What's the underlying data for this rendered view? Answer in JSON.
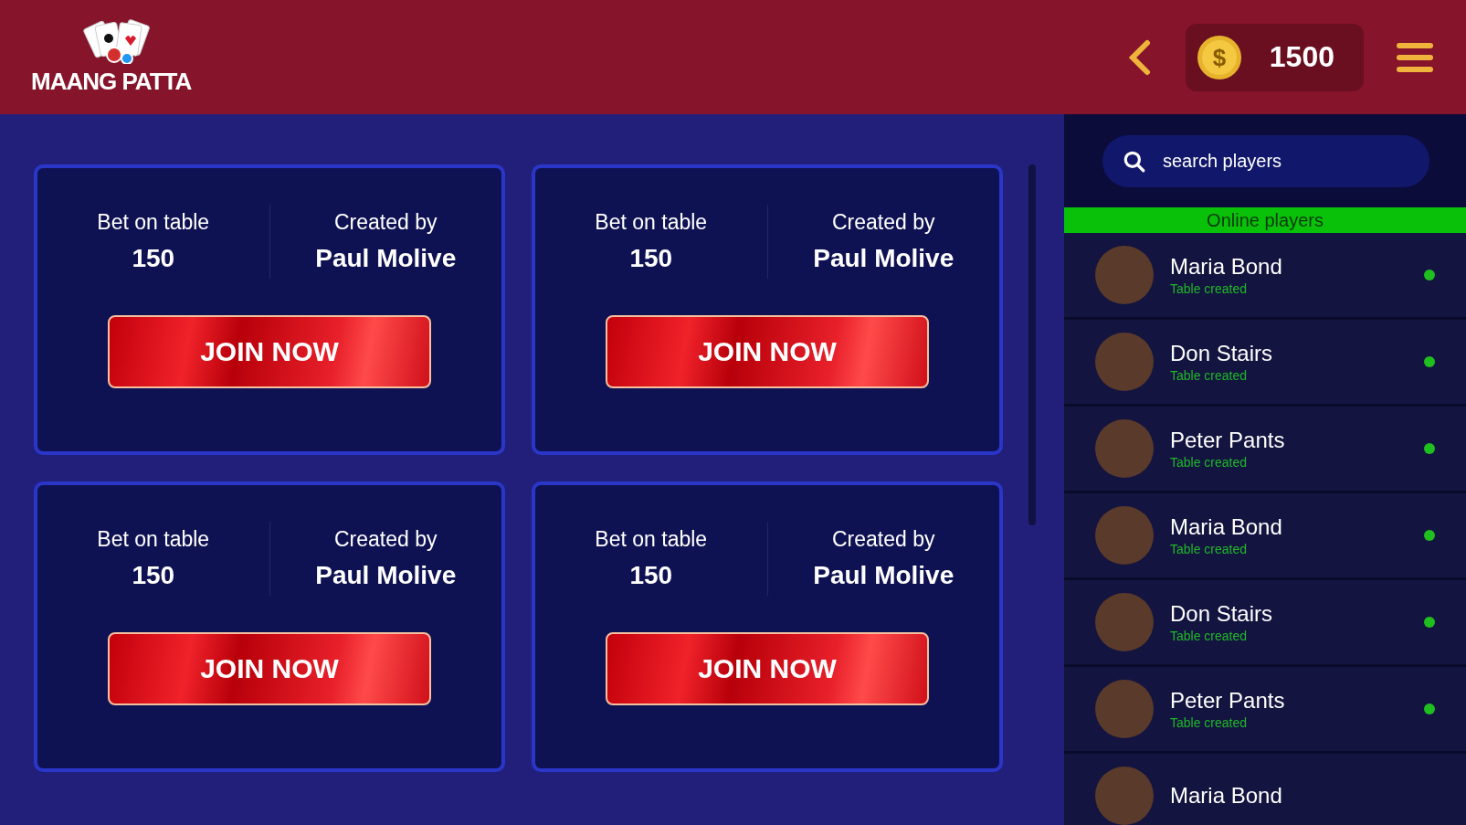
{
  "header": {
    "logo": "MAANG PATTA",
    "coin_symbol": "$",
    "coins": "1500"
  },
  "tables": [
    {
      "bet_label": "Bet on table",
      "bet": "150",
      "creator_label": "Created by",
      "creator": "Paul Molive",
      "button": "JOIN NOW"
    },
    {
      "bet_label": "Bet on table",
      "bet": "150",
      "creator_label": "Created by",
      "creator": "Paul Molive",
      "button": "JOIN NOW"
    },
    {
      "bet_label": "Bet on table",
      "bet": "150",
      "creator_label": "Created by",
      "creator": "Paul Molive",
      "button": "JOIN NOW"
    },
    {
      "bet_label": "Bet on table",
      "bet": "150",
      "creator_label": "Created by",
      "creator": "Paul Molive",
      "button": "JOIN NOW"
    }
  ],
  "sidebar": {
    "search": {
      "placeholder": "search players"
    },
    "heading": "Online players",
    "players": [
      {
        "name": "Maria Bond",
        "status": "Table created",
        "online": true
      },
      {
        "name": "Don Stairs",
        "status": "Table created",
        "online": true
      },
      {
        "name": "Peter Pants",
        "status": "Table created",
        "online": true
      },
      {
        "name": "Maria Bond",
        "status": "Table created",
        "online": true
      },
      {
        "name": "Don Stairs",
        "status": "Table created",
        "online": true
      },
      {
        "name": "Peter Pants",
        "status": "Table created",
        "online": true
      },
      {
        "name": "Maria Bond"
      }
    ]
  }
}
